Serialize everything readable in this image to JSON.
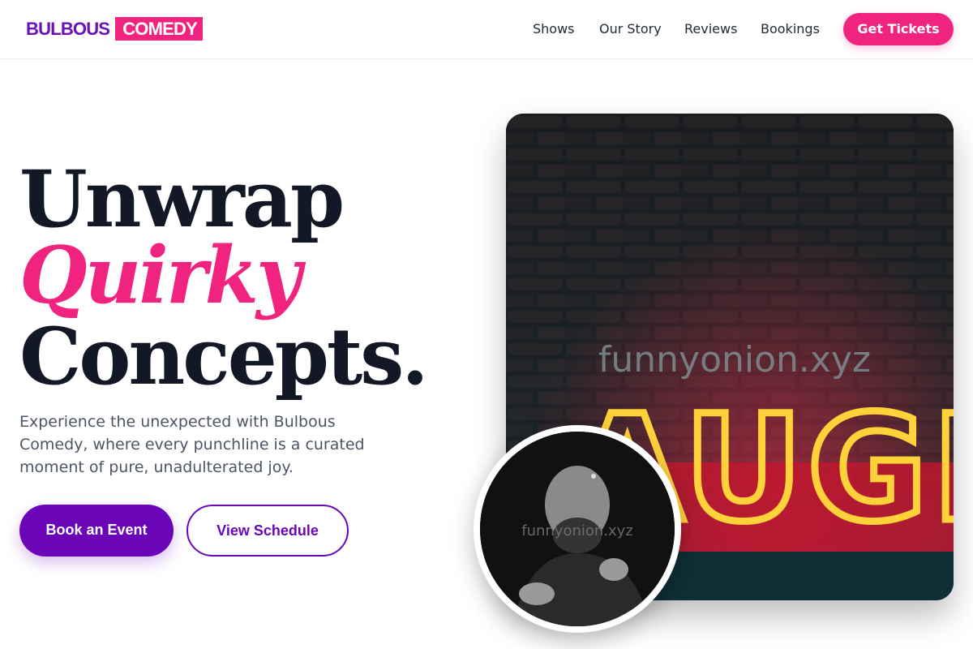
{
  "brand": {
    "part1": "BULBOUS",
    "part2": "COMEDY"
  },
  "nav": {
    "items": [
      "Shows",
      "Our Story",
      "Reviews",
      "Bookings"
    ],
    "cta": "Get Tickets"
  },
  "hero": {
    "line1": "Unwrap",
    "line2": "Quirky",
    "line3": "Concepts.",
    "subtext": "Experience the unexpected with Bulbous Comedy, where every punchline is a curated moment of pure, unadulterated joy.",
    "primary_button": "Book an Event",
    "secondary_button": "View Schedule",
    "image_watermark": "funnyonion.xyz",
    "neon_text": "AUGH",
    "avatar_watermark": "funnyonion.xyz"
  },
  "colors": {
    "brand_purple": "#6a06b8",
    "brand_pink": "#f0247e",
    "heading_dark": "#121826"
  },
  "icons": {
    "neon_sign": "neon-laugh-sign",
    "comedian_photo": "comedian-portrait"
  }
}
